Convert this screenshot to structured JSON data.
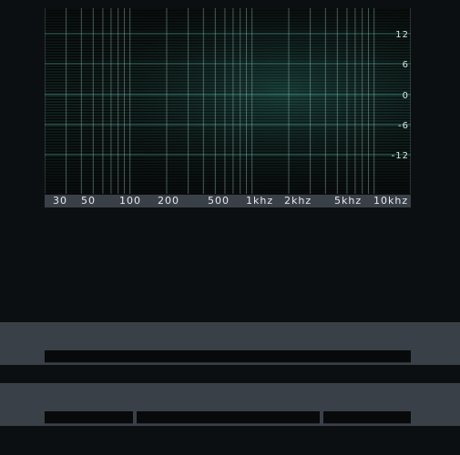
{
  "eq": {
    "db_labels": [
      "12",
      "6",
      "0",
      "-6",
      "-12"
    ],
    "freq_labels": [
      "30",
      "50",
      "100",
      "200",
      "500",
      "1khz",
      "2khz",
      "5khz",
      "10khz"
    ]
  },
  "colors": {
    "background": "#0c0f12",
    "display_bg": "#050606",
    "grid_cyan": "#5fd3c0",
    "panel": "#3a4047",
    "slot": "#07090b"
  }
}
